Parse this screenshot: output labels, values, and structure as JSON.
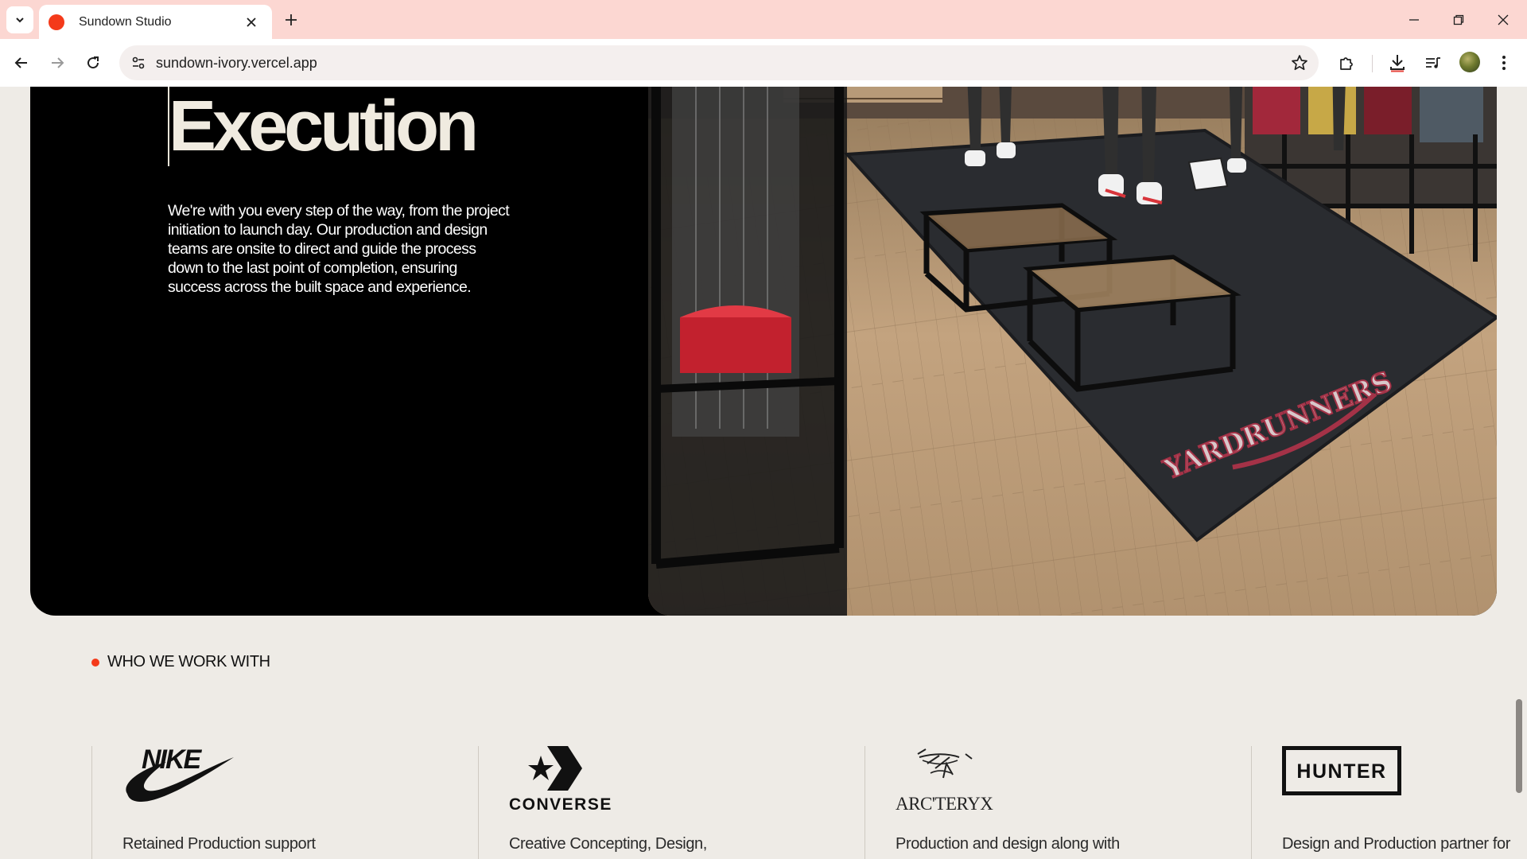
{
  "browser": {
    "tab_title": "Sundown Studio",
    "url": "sundown-ivory.vercel.app"
  },
  "hero": {
    "title": "Execution",
    "body": "We're with you every step of the way, from the project initiation to launch day. Our production and design teams are onsite to direct and guide the process down to the last point of completion, ensuring success across the built space and experience.",
    "image_text": "YARDRUNNERS"
  },
  "clients": {
    "label": "WHO WE WORK WITH",
    "brands": [
      {
        "name": "NIKE",
        "desc": "Retained Production support"
      },
      {
        "name": "CONVERSE",
        "desc": "Creative Concepting, Design,"
      },
      {
        "name": "ARC'TERYX",
        "desc": "Production and design along with"
      },
      {
        "name": "HUNTER",
        "desc": "Design and Production partner for"
      }
    ]
  },
  "colors": {
    "accent": "#f43a1a",
    "tabbar": "#fcd7d2",
    "page_bg": "#eeebe6",
    "hero_bg": "#000000"
  }
}
